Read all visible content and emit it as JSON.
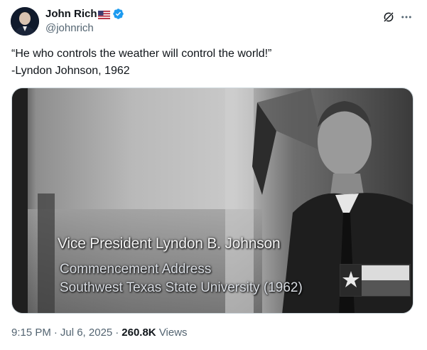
{
  "author": {
    "display_name": "John Rich",
    "handle": "@johnrich",
    "flag_emoji": "🇺🇸",
    "verified": true
  },
  "icons": {
    "avatar": "profile-photo",
    "flag": "us-flag-icon",
    "verified": "verified-badge-icon",
    "grok": "grok-icon",
    "more": "more-horizontal-icon"
  },
  "tweet": {
    "line1": "“He who controls the weather will control the world!”",
    "line2": "-Lyndon Johnson, 1962"
  },
  "media": {
    "caption_name": "Vice President Lyndon B. Johnson",
    "caption_event": "Commencement Address",
    "caption_school": "Southwest Texas State University (1962)"
  },
  "meta": {
    "time": "9:15 PM",
    "date": "Jul 6, 2025",
    "separator": "·",
    "views_count": "260.8K",
    "views_label": "Views"
  },
  "colors": {
    "text_primary": "#0f1419",
    "text_secondary": "#536471",
    "verified_blue": "#1d9bf0",
    "border": "#cfd9de"
  }
}
